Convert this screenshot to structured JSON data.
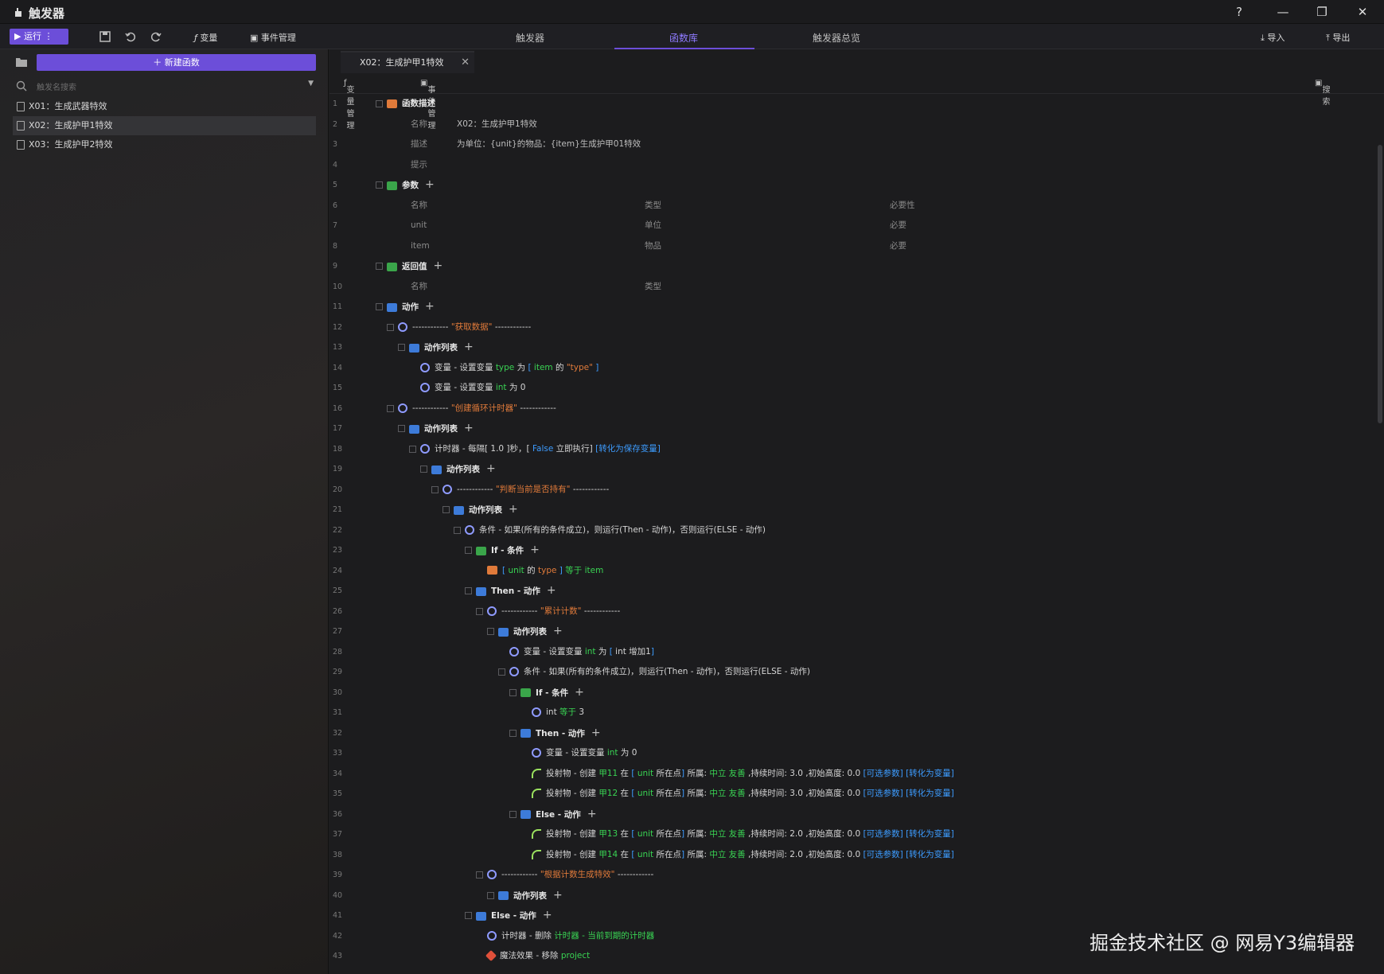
{
  "window": {
    "title": "触发器"
  },
  "toolbar": {
    "run": "运行",
    "variables": "变量",
    "events": "事件管理",
    "import": "导入",
    "export": "导出"
  },
  "top_tabs": [
    "触发器",
    "函数库",
    "触发器总览"
  ],
  "sidebar": {
    "new_function": "新建函数",
    "search_placeholder": "触发名搜索",
    "items": [
      "X01：生成武器特效",
      "X02：生成护甲1特效",
      "X03：生成护甲2特效"
    ]
  },
  "editor": {
    "tab": "X02：生成护甲1特效",
    "var_manage": "变量管理",
    "event_manage": "事件管理",
    "search": "搜索"
  },
  "lines": [
    {
      "n": "1",
      "parts": [
        {
          "c": "k",
          "t": "函数描述"
        }
      ]
    },
    {
      "n": "2",
      "parts": [
        {
          "c": "g",
          "t": "名称"
        }
      ],
      "val": "X02：生成护甲1特效"
    },
    {
      "n": "3",
      "parts": [
        {
          "c": "g",
          "t": "描述"
        }
      ],
      "val": "为单位：{unit}的物品：{item}生成护甲01特效"
    },
    {
      "n": "4",
      "parts": [
        {
          "c": "g",
          "t": "提示"
        }
      ]
    },
    {
      "n": "5",
      "parts": [
        {
          "c": "k",
          "t": "参数"
        }
      ]
    },
    {
      "n": "6",
      "parts": [
        {
          "c": "g",
          "t": "名称"
        }
      ],
      "col2": "类型",
      "col3": "必要性"
    },
    {
      "n": "7",
      "parts": [
        {
          "c": "g",
          "t": "unit"
        }
      ],
      "col2": "单位",
      "col3": "必要"
    },
    {
      "n": "8",
      "parts": [
        {
          "c": "g",
          "t": "item"
        }
      ],
      "col2": "物品",
      "col3": "必要"
    },
    {
      "n": "9",
      "parts": [
        {
          "c": "k",
          "t": "返回值"
        }
      ]
    },
    {
      "n": "10",
      "parts": [
        {
          "c": "g",
          "t": "名称"
        }
      ],
      "col2": "类型"
    },
    {
      "n": "11",
      "parts": [
        {
          "c": "k",
          "t": "动作"
        }
      ]
    },
    {
      "n": "12",
      "parts": [
        {
          "c": "t",
          "t": "------------ "
        },
        {
          "c": "o",
          "t": "\"获取数据\""
        },
        {
          "c": "t",
          "t": " ------------"
        }
      ]
    },
    {
      "n": "13",
      "parts": [
        {
          "c": "k",
          "t": "动作列表"
        }
      ]
    },
    {
      "n": "14",
      "parts": [
        {
          "c": "t",
          "t": "变量 - 设置变量 "
        },
        {
          "c": "gr",
          "t": "type"
        },
        {
          "c": "t",
          "t": " 为 "
        },
        {
          "c": "b",
          "t": "["
        },
        {
          "c": "t",
          "t": " "
        },
        {
          "c": "gr",
          "t": "item"
        },
        {
          "c": "t",
          "t": " 的 "
        },
        {
          "c": "o",
          "t": "\"type\""
        },
        {
          "c": "b",
          "t": " ]"
        }
      ]
    },
    {
      "n": "15",
      "parts": [
        {
          "c": "t",
          "t": "变量 - 设置变量 "
        },
        {
          "c": "gr",
          "t": "int"
        },
        {
          "c": "t",
          "t": " 为 0"
        }
      ]
    },
    {
      "n": "16",
      "parts": [
        {
          "c": "t",
          "t": "------------ "
        },
        {
          "c": "o",
          "t": "\"创建循环计时器\""
        },
        {
          "c": "t",
          "t": " ------------"
        }
      ]
    },
    {
      "n": "17",
      "parts": [
        {
          "c": "k",
          "t": "动作列表"
        }
      ]
    },
    {
      "n": "18",
      "parts": [
        {
          "c": "t",
          "t": "计时器 - 每隔[ 1.0 ]秒，[ "
        },
        {
          "c": "b",
          "t": "False"
        },
        {
          "c": "t",
          "t": " 立即执行]  "
        },
        {
          "c": "b",
          "t": "[转化为保存变量]"
        }
      ]
    },
    {
      "n": "19",
      "parts": [
        {
          "c": "k",
          "t": "动作列表"
        }
      ]
    },
    {
      "n": "20",
      "parts": [
        {
          "c": "t",
          "t": "------------ "
        },
        {
          "c": "o",
          "t": "\"判断当前是否持有\""
        },
        {
          "c": "t",
          "t": " ------------"
        }
      ]
    },
    {
      "n": "21",
      "parts": [
        {
          "c": "k",
          "t": "动作列表"
        }
      ]
    },
    {
      "n": "22",
      "parts": [
        {
          "c": "t",
          "t": "条件 - 如果(所有的条件成立)，则运行(Then - 动作)，否则运行(ELSE - 动作)"
        }
      ]
    },
    {
      "n": "23",
      "parts": [
        {
          "c": "k",
          "t": "If - 条件"
        }
      ]
    },
    {
      "n": "24",
      "parts": [
        {
          "c": "b",
          "t": "["
        },
        {
          "c": "t",
          "t": " "
        },
        {
          "c": "gr",
          "t": "unit"
        },
        {
          "c": "t",
          "t": " 的 "
        },
        {
          "c": "o",
          "t": "type"
        },
        {
          "c": "b",
          "t": " ]"
        },
        {
          "c": "t",
          "t": "  "
        },
        {
          "c": "gr",
          "t": "等于"
        },
        {
          "c": "t",
          "t": "  "
        },
        {
          "c": "gr",
          "t": "item"
        }
      ]
    },
    {
      "n": "25",
      "parts": [
        {
          "c": "k",
          "t": "Then - 动作"
        }
      ]
    },
    {
      "n": "26",
      "parts": [
        {
          "c": "t",
          "t": "------------ "
        },
        {
          "c": "o",
          "t": "\"累计计数\""
        },
        {
          "c": "t",
          "t": " ------------"
        }
      ]
    },
    {
      "n": "27",
      "parts": [
        {
          "c": "k",
          "t": "动作列表"
        }
      ]
    },
    {
      "n": "28",
      "parts": [
        {
          "c": "t",
          "t": "变量 - 设置变量 "
        },
        {
          "c": "gr",
          "t": "int"
        },
        {
          "c": "t",
          "t": " 为 "
        },
        {
          "c": "b",
          "t": "["
        },
        {
          "c": "t",
          "t": " int 增加1"
        },
        {
          "c": "b",
          "t": "]"
        }
      ]
    },
    {
      "n": "29",
      "parts": [
        {
          "c": "t",
          "t": "条件 - 如果(所有的条件成立)，则运行(Then - 动作)，否则运行(ELSE - 动作)"
        }
      ]
    },
    {
      "n": "30",
      "parts": [
        {
          "c": "k",
          "t": "If - 条件"
        }
      ]
    },
    {
      "n": "31",
      "parts": [
        {
          "c": "t",
          "t": "int  "
        },
        {
          "c": "gr",
          "t": "等于"
        },
        {
          "c": "t",
          "t": "  3"
        }
      ]
    },
    {
      "n": "32",
      "parts": [
        {
          "c": "k",
          "t": "Then - 动作"
        }
      ]
    },
    {
      "n": "33",
      "parts": [
        {
          "c": "t",
          "t": "变量 - 设置变量 "
        },
        {
          "c": "gr",
          "t": "int"
        },
        {
          "c": "t",
          "t": " 为 0"
        }
      ]
    },
    {
      "n": "34",
      "parts": [
        {
          "c": "t",
          "t": "投射物 - 创建 "
        },
        {
          "c": "gr",
          "t": "甲11"
        },
        {
          "c": "t",
          "t": " 在 "
        },
        {
          "c": "b",
          "t": "["
        },
        {
          "c": "t",
          "t": " "
        },
        {
          "c": "gr",
          "t": "unit"
        },
        {
          "c": "t",
          "t": " 所在点"
        },
        {
          "c": "b",
          "t": "]"
        },
        {
          "c": "t",
          "t": " 所属: "
        },
        {
          "c": "gr",
          "t": "中立 友善"
        },
        {
          "c": "t",
          "t": " ,持续时间: 3.0 ,初始高度: 0.0   "
        },
        {
          "c": "b",
          "t": "[可选参数]"
        },
        {
          "c": "t",
          "t": "   "
        },
        {
          "c": "b",
          "t": "[转化为变量]"
        }
      ]
    },
    {
      "n": "35",
      "parts": [
        {
          "c": "t",
          "t": "投射物 - 创建 "
        },
        {
          "c": "gr",
          "t": "甲12"
        },
        {
          "c": "t",
          "t": " 在 "
        },
        {
          "c": "b",
          "t": "["
        },
        {
          "c": "t",
          "t": " "
        },
        {
          "c": "gr",
          "t": "unit"
        },
        {
          "c": "t",
          "t": " 所在点"
        },
        {
          "c": "b",
          "t": "]"
        },
        {
          "c": "t",
          "t": " 所属: "
        },
        {
          "c": "gr",
          "t": "中立 友善"
        },
        {
          "c": "t",
          "t": " ,持续时间: 3.0 ,初始高度: 0.0   "
        },
        {
          "c": "b",
          "t": "[可选参数]"
        },
        {
          "c": "t",
          "t": "   "
        },
        {
          "c": "b",
          "t": "[转化为变量]"
        }
      ]
    },
    {
      "n": "36",
      "parts": [
        {
          "c": "k",
          "t": "Else - 动作"
        }
      ]
    },
    {
      "n": "37",
      "parts": [
        {
          "c": "t",
          "t": "投射物 - 创建 "
        },
        {
          "c": "gr",
          "t": "甲13"
        },
        {
          "c": "t",
          "t": " 在 "
        },
        {
          "c": "b",
          "t": "["
        },
        {
          "c": "t",
          "t": " "
        },
        {
          "c": "gr",
          "t": "unit"
        },
        {
          "c": "t",
          "t": " 所在点"
        },
        {
          "c": "b",
          "t": "]"
        },
        {
          "c": "t",
          "t": " 所属: "
        },
        {
          "c": "gr",
          "t": "中立 友善"
        },
        {
          "c": "t",
          "t": " ,持续时间: 2.0 ,初始高度: 0.0   "
        },
        {
          "c": "b",
          "t": "[可选参数]"
        },
        {
          "c": "t",
          "t": "   "
        },
        {
          "c": "b",
          "t": "[转化为变量]"
        }
      ]
    },
    {
      "n": "38",
      "parts": [
        {
          "c": "t",
          "t": "投射物 - 创建 "
        },
        {
          "c": "gr",
          "t": "甲14"
        },
        {
          "c": "t",
          "t": " 在 "
        },
        {
          "c": "b",
          "t": "["
        },
        {
          "c": "t",
          "t": " "
        },
        {
          "c": "gr",
          "t": "unit"
        },
        {
          "c": "t",
          "t": " 所在点"
        },
        {
          "c": "b",
          "t": "]"
        },
        {
          "c": "t",
          "t": " 所属: "
        },
        {
          "c": "gr",
          "t": "中立 友善"
        },
        {
          "c": "t",
          "t": " ,持续时间: 2.0 ,初始高度: 0.0   "
        },
        {
          "c": "b",
          "t": "[可选参数]"
        },
        {
          "c": "t",
          "t": "   "
        },
        {
          "c": "b",
          "t": "[转化为变量]"
        }
      ]
    },
    {
      "n": "39",
      "parts": [
        {
          "c": "t",
          "t": "------------ "
        },
        {
          "c": "o",
          "t": "\"根据计数生成特效\""
        },
        {
          "c": "t",
          "t": " ------------"
        }
      ]
    },
    {
      "n": "40",
      "parts": [
        {
          "c": "k",
          "t": "动作列表"
        }
      ]
    },
    {
      "n": "41",
      "parts": [
        {
          "c": "k",
          "t": "Else - 动作"
        }
      ]
    },
    {
      "n": "42",
      "parts": [
        {
          "c": "t",
          "t": "计时器 - 删除 "
        },
        {
          "c": "gr",
          "t": "计时器 - 当前到期的计时器"
        }
      ]
    },
    {
      "n": "43",
      "parts": [
        {
          "c": "t",
          "t": "魔法效果 - 移除 "
        },
        {
          "c": "gr",
          "t": "project"
        }
      ]
    }
  ],
  "watermark": "掘金技术社区 @ 网易Y3编辑器",
  "colors": {
    "accent": "#6c4ed9",
    "keyword_orange": "#e07a3a",
    "link_blue": "#3d9cff",
    "value_green": "#39d353"
  }
}
